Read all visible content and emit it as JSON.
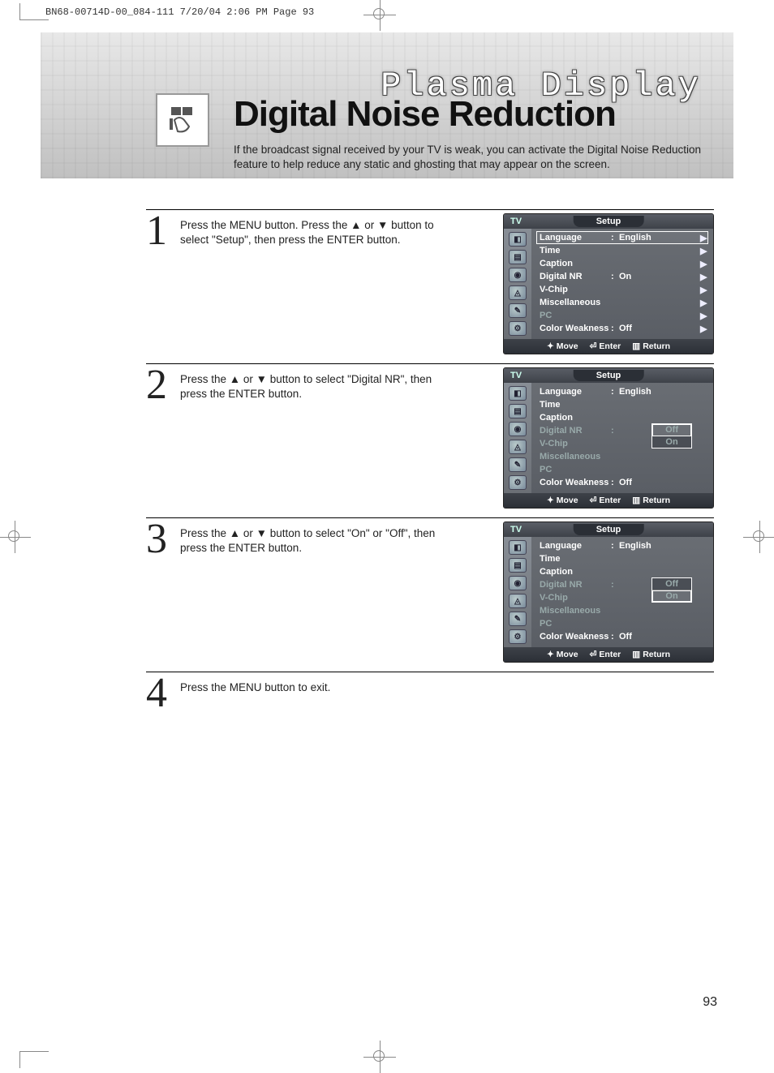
{
  "crop_header": "BN68-00714D-00_084-111  7/20/04  2:06 PM  Page 93",
  "header": {
    "plasma_title": "Plasma Display",
    "page_title": "Digital Noise Reduction",
    "intro": "If the broadcast signal received by your TV is weak, you can activate the Digital Noise Reduction feature to help reduce any static and ghosting that may appear on the screen."
  },
  "steps": [
    {
      "num": "1",
      "text": "Press the MENU button. Press the ▲ or ▼ button to select \"Setup\", then press the ENTER button."
    },
    {
      "num": "2",
      "text": "Press the ▲ or ▼ button to select \"Digital NR\", then press the ENTER button."
    },
    {
      "num": "3",
      "text": "Press the ▲ or ▼ button to select \"On\" or \"Off\", then press the ENTER button."
    },
    {
      "num": "4",
      "text": "Press the MENU button to exit."
    }
  ],
  "osd_common": {
    "tv": "TV",
    "title": "Setup",
    "footer_move": "Move",
    "footer_enter": "Enter",
    "footer_return": "Return"
  },
  "osd1": {
    "rows": [
      {
        "label": "Language",
        "val": "English",
        "arrow": true,
        "sel": true
      },
      {
        "label": "Time",
        "val": "",
        "arrow": true
      },
      {
        "label": "Caption",
        "val": "",
        "arrow": true
      },
      {
        "label": "Digital NR",
        "val": "On",
        "arrow": true
      },
      {
        "label": "V-Chip",
        "val": "",
        "arrow": true
      },
      {
        "label": "Miscellaneous",
        "val": "",
        "arrow": true
      },
      {
        "label": "PC",
        "val": "",
        "arrow": true,
        "dim": true
      },
      {
        "label": "Color Weakness",
        "val": "Off",
        "arrow": true
      }
    ]
  },
  "osd2": {
    "rows": [
      {
        "label": "Language",
        "val": "English"
      },
      {
        "label": "Time",
        "val": ""
      },
      {
        "label": "Caption",
        "val": ""
      },
      {
        "label": "Digital NR",
        "val": "",
        "dim": true,
        "opts": [
          "Off",
          "On"
        ],
        "optSel": 0
      },
      {
        "label": "V-Chip",
        "val": "",
        "dim": true
      },
      {
        "label": "Miscellaneous",
        "val": "",
        "dim": true
      },
      {
        "label": "PC",
        "val": "",
        "dim": true
      },
      {
        "label": "Color Weakness",
        "val": "Off"
      }
    ]
  },
  "osd3": {
    "rows": [
      {
        "label": "Language",
        "val": "English"
      },
      {
        "label": "Time",
        "val": ""
      },
      {
        "label": "Caption",
        "val": ""
      },
      {
        "label": "Digital NR",
        "val": "",
        "dim": true,
        "opts": [
          "Off",
          "On"
        ],
        "optSel": 1
      },
      {
        "label": "V-Chip",
        "val": "",
        "dim": true
      },
      {
        "label": "Miscellaneous",
        "val": "",
        "dim": true
      },
      {
        "label": "PC",
        "val": "",
        "dim": true
      },
      {
        "label": "Color Weakness",
        "val": "Off"
      }
    ]
  },
  "page_num": "93"
}
